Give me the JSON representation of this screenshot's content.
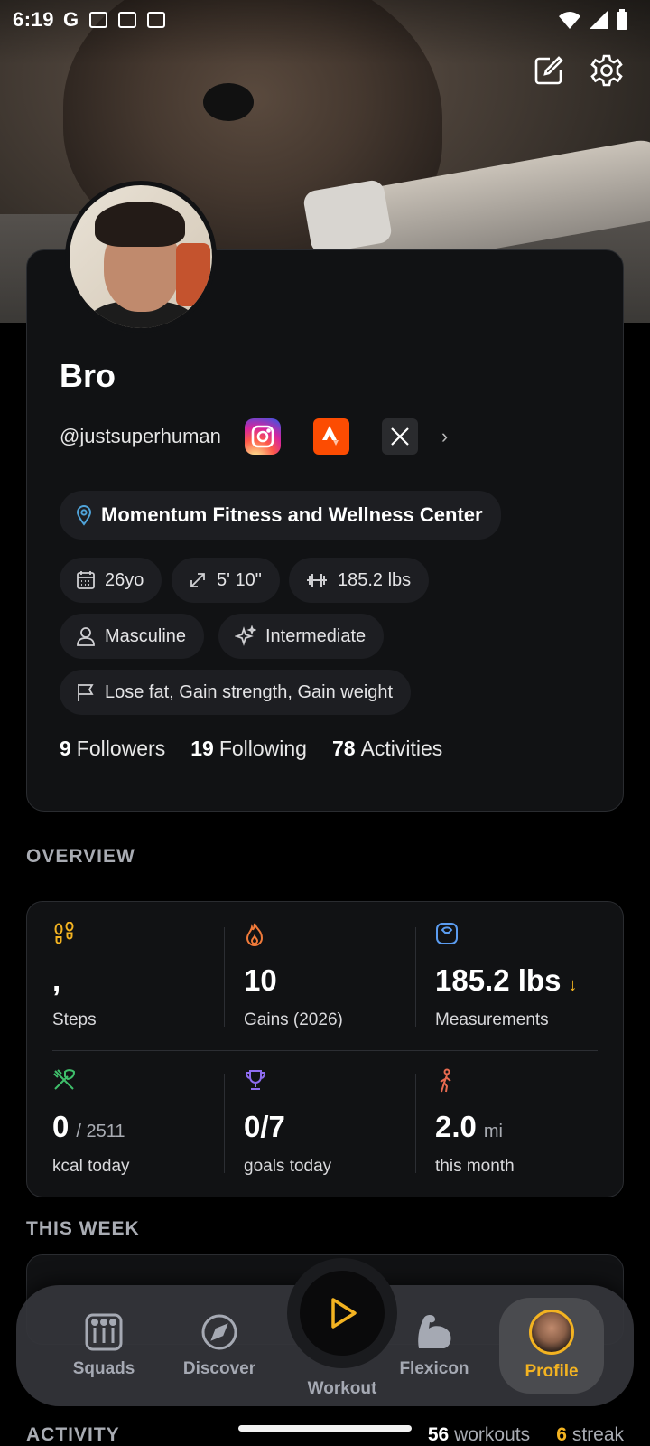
{
  "status_bar": {
    "time": "6:19",
    "carrier_glyph": "G"
  },
  "colors": {
    "accent": "#f3b321",
    "card": "#111214",
    "chip": "#1d1e22",
    "location_pin": "#4fa3d9"
  },
  "profile": {
    "name": "Bro",
    "handle": "@justsuperhuman",
    "socials": [
      "instagram-icon",
      "strava-icon",
      "x-icon"
    ],
    "gym": "Momentum Fitness and Wellness Center",
    "age": "26yo",
    "height": "5' 10\"",
    "weight": "185.2 lbs",
    "gender": "Masculine",
    "level": "Intermediate",
    "goals": "Lose fat, Gain strength, Gain weight",
    "followers_count": "9",
    "followers_label": "Followers",
    "following_count": "19",
    "following_label": "Following",
    "activities_count": "78",
    "activities_label": "Activities"
  },
  "overview": {
    "title": "OVERVIEW",
    "cells": [
      {
        "icon": "footprints-icon",
        "value": ",",
        "sub": "",
        "label": "Steps"
      },
      {
        "icon": "flame-icon",
        "value": "10",
        "sub": "",
        "label": "Gains (2026)"
      },
      {
        "icon": "scale-icon",
        "value": "185.2 lbs",
        "sub": "↓",
        "label": "Measurements"
      },
      {
        "icon": "utensils-icon",
        "value": "0",
        "sub": "/ 2511",
        "label": "kcal today"
      },
      {
        "icon": "trophy-icon",
        "value": "0/7",
        "sub": "",
        "label": "goals today"
      },
      {
        "icon": "walking-icon",
        "value": "2.0",
        "sub": "mi",
        "label": "this month"
      }
    ]
  },
  "this_week": {
    "title": "THIS WEEK"
  },
  "nav": {
    "squads": "Squads",
    "discover": "Discover",
    "workout": "Workout",
    "flexicon": "Flexicon",
    "profile": "Profile"
  },
  "activity": {
    "title": "ACTIVITY",
    "workouts_count": "56",
    "workouts_label": "workouts",
    "streak_count": "6",
    "streak_label": "streak"
  }
}
